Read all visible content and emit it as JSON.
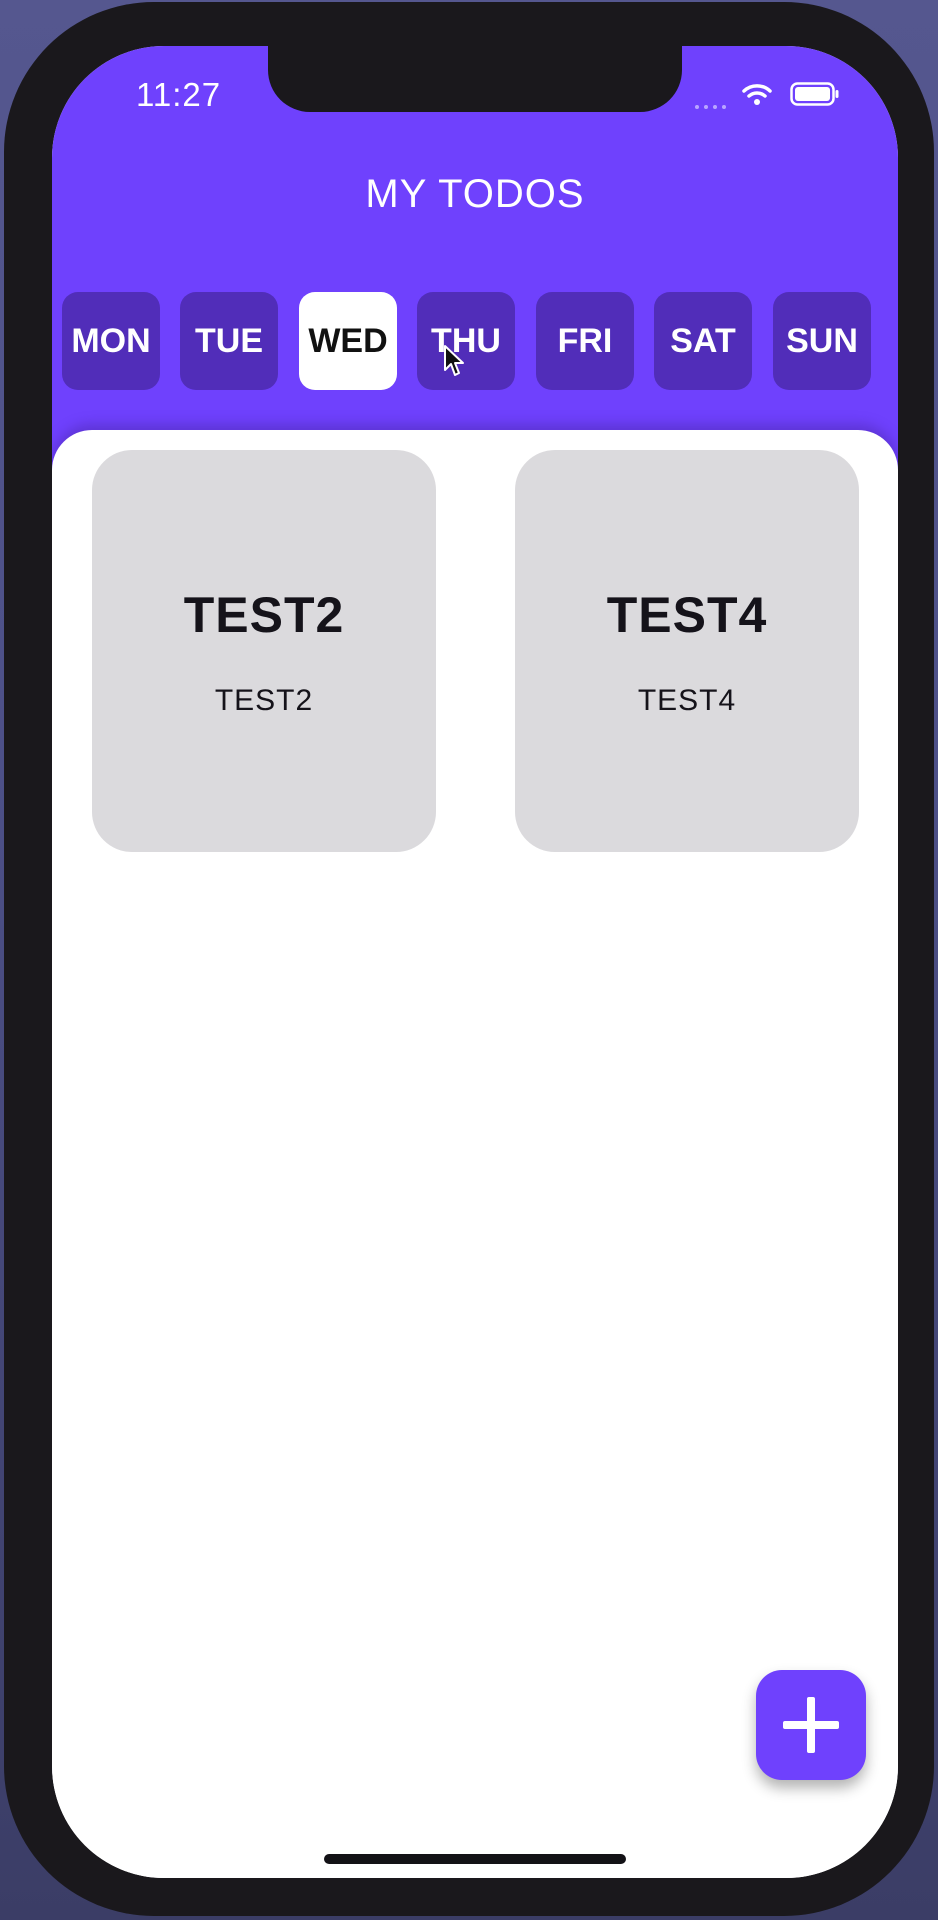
{
  "status_bar": {
    "time": "11:27",
    "icons": [
      "cellular-signal-icon",
      "wifi-icon",
      "battery-icon"
    ]
  },
  "app": {
    "title": "MY TODOS"
  },
  "days": {
    "items": [
      {
        "label": "MON",
        "selected": false
      },
      {
        "label": "TUE",
        "selected": false
      },
      {
        "label": "WED",
        "selected": true
      },
      {
        "label": "THU",
        "selected": false
      },
      {
        "label": "FRI",
        "selected": false
      },
      {
        "label": "SAT",
        "selected": false
      },
      {
        "label": "SUN",
        "selected": false
      }
    ]
  },
  "todos": [
    {
      "title": "TEST2",
      "description": "TEST2"
    },
    {
      "title": "TEST4",
      "description": "TEST4"
    }
  ],
  "fab": {
    "icon": "plus-icon"
  },
  "colors": {
    "accent": "#6f41fd",
    "tab_inactive": "#512db9",
    "tab_active": "#ffffff",
    "card": "#dbdadd",
    "frame": "#1a181c"
  }
}
